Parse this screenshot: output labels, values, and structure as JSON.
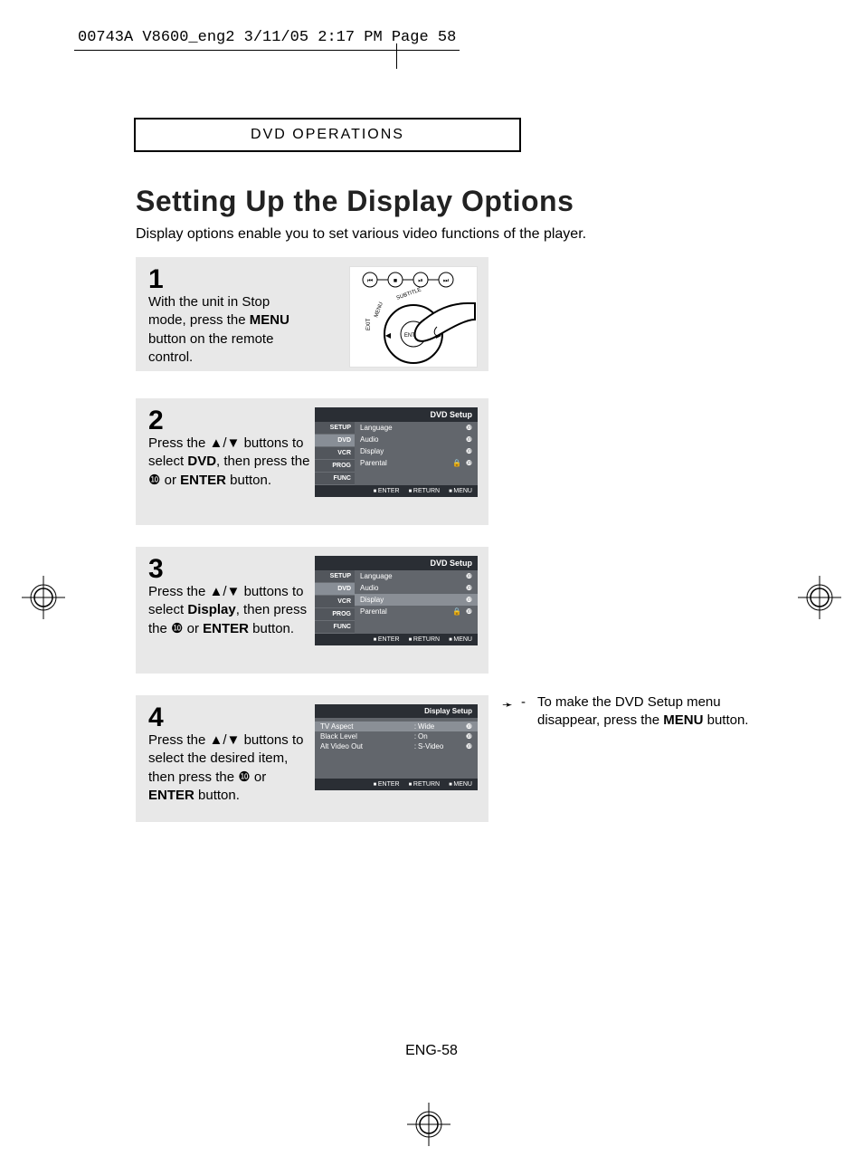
{
  "printer_slug": "00743A V8600_eng2  3/11/05  2:17 PM  Page 58",
  "section_header": "DVD OPERATIONS",
  "title": "Setting Up the Display Options",
  "intro": "Display options enable you to set various video functions of the player.",
  "steps": {
    "s1": {
      "num": "1",
      "text_before": "With the unit in Stop mode, press the ",
      "bold": "MENU",
      "text_after": " button on the remote control.",
      "remote_labels": {
        "subtitle": "SUBTITLE",
        "menu": "MENU",
        "enter": "ENTER",
        "exit": "EXIT"
      }
    },
    "s2": {
      "num": "2",
      "line1_a": "Press the ",
      "line1_glyph": "▲/▼",
      "line1_b": " buttons to select ",
      "bold1": "DVD",
      "line1_c": ", then press the ",
      "glyph_right": "❿",
      "line2_a": "or ",
      "bold2": "ENTER",
      "line2_b": " button."
    },
    "s3": {
      "num": "3",
      "line1_a": "Press the ",
      "line1_glyph": "▲/▼",
      "line1_b": " buttons to select ",
      "bold1": "Display",
      "line1_c": ", then press the ",
      "glyph_right": "❿",
      "line2_a": " or ",
      "bold2": "ENTER",
      "line2_b": " button."
    },
    "s4": {
      "num": "4",
      "line1_a": "Press the ",
      "line1_glyph": "▲/▼",
      "line1_b": " buttons to select the desired item, then press the ",
      "glyph_right": "❿",
      "line2_a": " or ",
      "bold2": "ENTER",
      "line2_b": " button."
    }
  },
  "osd": {
    "title": "DVD Setup",
    "sidebar": [
      "SETUP",
      "DVD",
      "VCR",
      "PROG",
      "FUNC"
    ],
    "items": [
      "Language",
      "Audio",
      "Display",
      "Parental"
    ],
    "lock_glyph": "🔒",
    "arrow_glyph": "❿",
    "footer": [
      "ENTER",
      "RETURN",
      "MENU"
    ]
  },
  "osd_display": {
    "title": "Display Setup",
    "rows": [
      {
        "label": "TV Aspect",
        "value": "Wide"
      },
      {
        "label": "Black Level",
        "value": "On"
      },
      {
        "label": "Alt Video Out",
        "value": "S-Video"
      }
    ],
    "colon": ":",
    "arrow_glyph": "❿",
    "footer": [
      "ENTER",
      "RETURN",
      "MENU"
    ]
  },
  "side_note": {
    "arrow": "➛",
    "dash": "-",
    "text_a": "To make the DVD Setup menu disappear, press the ",
    "bold": "MENU",
    "text_b": " button."
  },
  "page_number": "ENG-58"
}
